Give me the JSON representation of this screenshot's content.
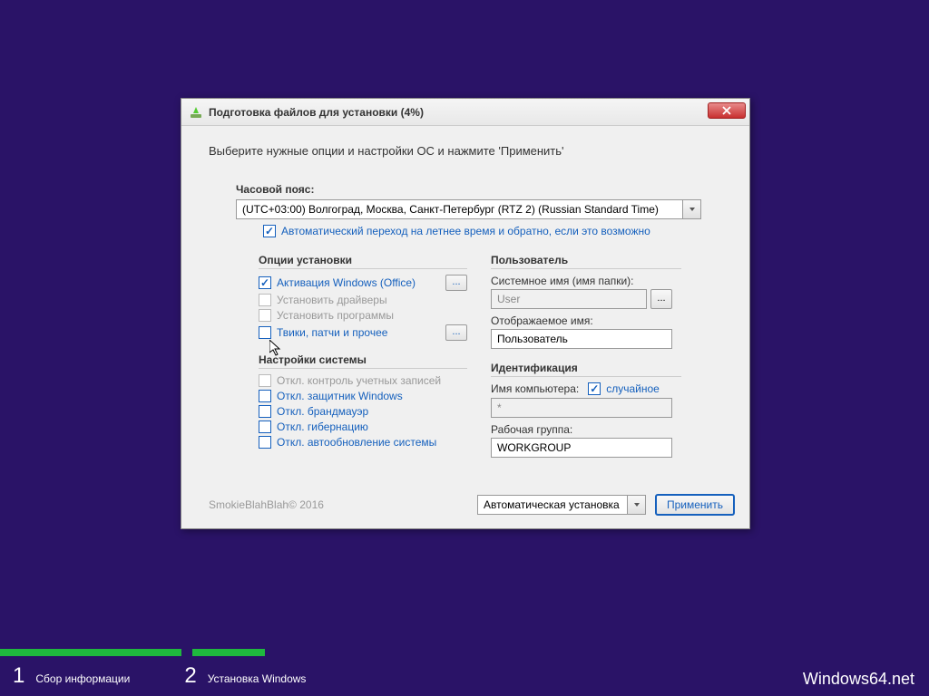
{
  "title": "Подготовка файлов для установки (4%)",
  "instruction": "Выберите нужные опции и настройки ОС и нажмите 'Применить'",
  "timezone": {
    "label": "Часовой пояс:",
    "value": "(UTC+03:00) Волгоград, Москва, Санкт-Петербург (RTZ 2) (Russian Standard Time)",
    "dst": "Автоматический переход на летнее время и обратно, если это возможно"
  },
  "install_options": {
    "header": "Опции установки",
    "activate": "Активация Windows (Office)",
    "drivers": "Установить драйверы",
    "programs": "Установить программы",
    "tweaks": "Твики, патчи и прочее",
    "ellipsis": "..."
  },
  "system_settings": {
    "header": "Настройки системы",
    "uac": "Откл. контроль учетных записей",
    "defender": "Откл. защитник Windows",
    "firewall": "Откл. брандмауэр",
    "hibernate": "Откл. гибернацию",
    "autoupdate": "Откл. автообновление системы"
  },
  "user": {
    "header": "Пользователь",
    "sysname_label": "Системное имя (имя папки):",
    "sysname_value": "User",
    "displayname_label": "Отображаемое имя:",
    "displayname_value": "Пользователь",
    "browse": "..."
  },
  "ident": {
    "header": "Идентификация",
    "computer_label": "Имя компьютера:",
    "random": "случайное",
    "computer_value": "*",
    "workgroup_label": "Рабочая группа:",
    "workgroup_value": "WORKGROUP"
  },
  "footer": {
    "copyright": "SmokieBlahBlah© 2016",
    "mode": "Автоматическая установка",
    "apply": "Применить"
  },
  "steps": {
    "s1_num": "1",
    "s1_text": "Сбор информации",
    "s2_num": "2",
    "s2_text": "Установка Windows"
  },
  "watermark": "Windows64.net"
}
